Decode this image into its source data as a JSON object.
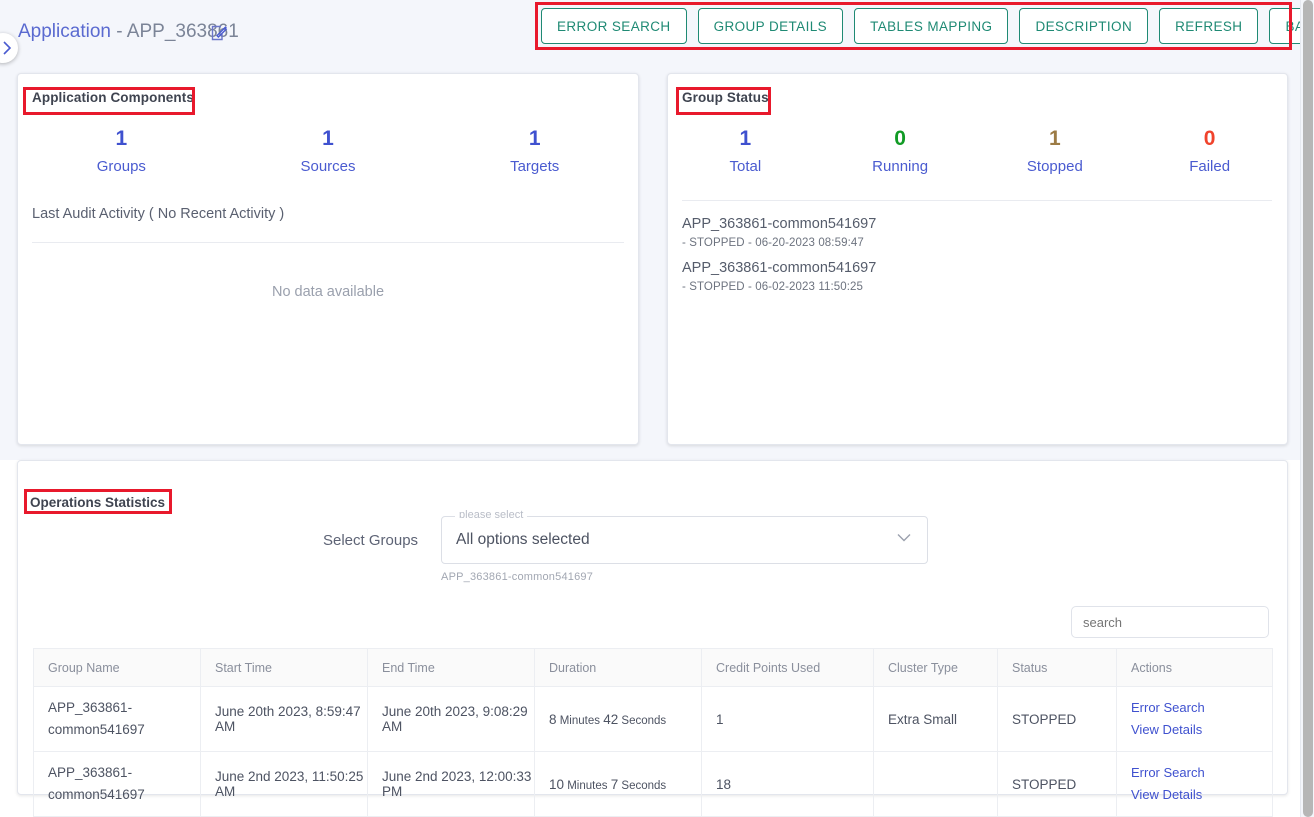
{
  "header": {
    "title_prefix": "Application",
    "title_sep": " - ",
    "title_value": "APP_363861",
    "edit_icon": "edit-square-icon",
    "sidebar_toggle_icon": "chevron-right-icon"
  },
  "toolbar": {
    "buttons": [
      {
        "label": "ERROR SEARCH"
      },
      {
        "label": "GROUP DETAILS"
      },
      {
        "label": "TABLES MAPPING"
      },
      {
        "label": "DESCRIPTION"
      },
      {
        "label": "REFRESH"
      },
      {
        "label": "BACK"
      }
    ],
    "accent_color": "#1f8a74"
  },
  "components_card": {
    "title": "Application Components",
    "stats": [
      {
        "value": "1",
        "label": "Groups",
        "color": "#3f51cf"
      },
      {
        "value": "1",
        "label": "Sources",
        "color": "#3f51cf"
      },
      {
        "value": "1",
        "label": "Targets",
        "color": "#3f51cf"
      }
    ],
    "audit_line": "Last Audit Activity ( No Recent Activity )",
    "empty_text": "No data available"
  },
  "group_status_card": {
    "title": "Group Status",
    "stats": [
      {
        "value": "1",
        "label": "Total",
        "color": "#3f51cf"
      },
      {
        "value": "0",
        "label": "Running",
        "color": "#119b25"
      },
      {
        "value": "1",
        "label": "Stopped",
        "color": "#9c7b45"
      },
      {
        "value": "0",
        "label": "Failed",
        "color": "#f0432c"
      }
    ],
    "groups": [
      {
        "name": "APP_363861-common541697",
        "meta": "- STOPPED - 06-20-2023 08:59:47"
      },
      {
        "name": "APP_363861-common541697",
        "meta": "- STOPPED - 06-02-2023 11:50:25"
      }
    ]
  },
  "operations": {
    "title": "Operations Statistics",
    "select_label": "Select Groups",
    "select_float_label": "please select",
    "select_value": "All options selected",
    "select_helper": "APP_363861-common541697",
    "select_chevron_icon": "chevron-down-icon",
    "search_placeholder": "search",
    "search_value": "",
    "table": {
      "columns": [
        "Group Name",
        "Start Time",
        "End Time",
        "Duration",
        "Credit Points Used",
        "Cluster Type",
        "Status",
        "Actions"
      ],
      "rows": [
        {
          "group_name": "APP_363861-common541697",
          "start_time": "June 20th 2023, 8:59:47 AM",
          "end_time": "June 20th 2023, 9:08:29 AM",
          "duration_minutes": "8",
          "duration_minutes_unit": " Minutes ",
          "duration_seconds": "42",
          "duration_seconds_unit": " Seconds",
          "credit_points_used": "1",
          "cluster_type": "Extra Small",
          "status": "STOPPED",
          "action_error_search": "Error Search",
          "action_view_details": "View Details"
        },
        {
          "group_name": "APP_363861-common541697",
          "start_time": "June 2nd 2023, 11:50:25 AM",
          "end_time": "June 2nd 2023, 12:00:33 PM",
          "duration_minutes": "10",
          "duration_minutes_unit": " Minutes ",
          "duration_seconds": "7",
          "duration_seconds_unit": " Seconds",
          "credit_points_used": "18",
          "cluster_type": "",
          "status": "STOPPED",
          "action_error_search": "Error Search",
          "action_view_details": "View Details"
        }
      ]
    }
  },
  "annotations": {
    "color": "#e8192c"
  }
}
